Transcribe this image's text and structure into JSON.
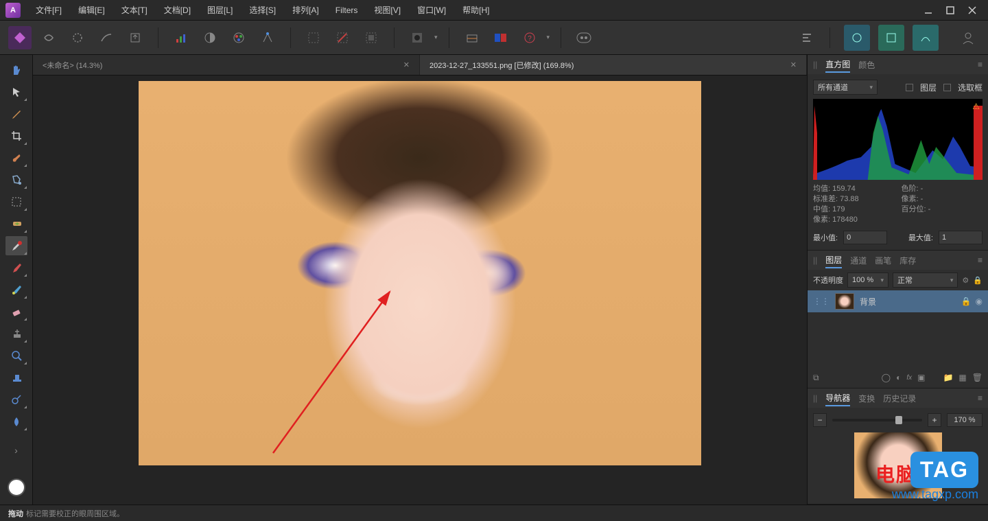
{
  "menu": {
    "items": [
      "文件[F]",
      "编辑[E]",
      "文本[T]",
      "文档[D]",
      "图层[L]",
      "选择[S]",
      "排列[A]",
      "Filters",
      "视图[V]",
      "窗口[W]",
      "帮助[H]"
    ]
  },
  "tabs": [
    {
      "label": "<未命名> (14.3%)",
      "active": false
    },
    {
      "label": "2023-12-27_133551.png [已修改] (169.8%)",
      "active": true
    }
  ],
  "histogram_panel": {
    "tabs": [
      "直方图",
      "颜色"
    ],
    "channel": "所有通道",
    "chk_layer": "图层",
    "chk_marquee": "选取框",
    "stats": {
      "mean_label": "均值:",
      "mean": "159.74",
      "std_label": "标准差:",
      "std": "73.88",
      "median_label": "中值:",
      "median": "179",
      "pixels_label": "像素:",
      "pixels": "178480",
      "levels_label": "色阶:",
      "levels": "-",
      "px_label": "像素:",
      "px": "-",
      "pct_label": "百分位:",
      "pct": "-"
    },
    "min_label": "最小值:",
    "min": "0",
    "max_label": "最大值:",
    "max": "1"
  },
  "layers_panel": {
    "tabs": [
      "图层",
      "通道",
      "画笔",
      "库存"
    ],
    "opacity_label": "不透明度",
    "opacity": "100 %",
    "blend": "正常",
    "layer_name": "背景"
  },
  "nav_panel": {
    "tabs": [
      "导航器",
      "变换",
      "历史记录"
    ],
    "zoom": "170 %"
  },
  "status": {
    "action": "拖动",
    "hint": "标记需要校正的眼周围区域。"
  },
  "watermark": {
    "tag": "TAG",
    "cn": "电脑技术网",
    "url": "www.tagxp.com"
  }
}
